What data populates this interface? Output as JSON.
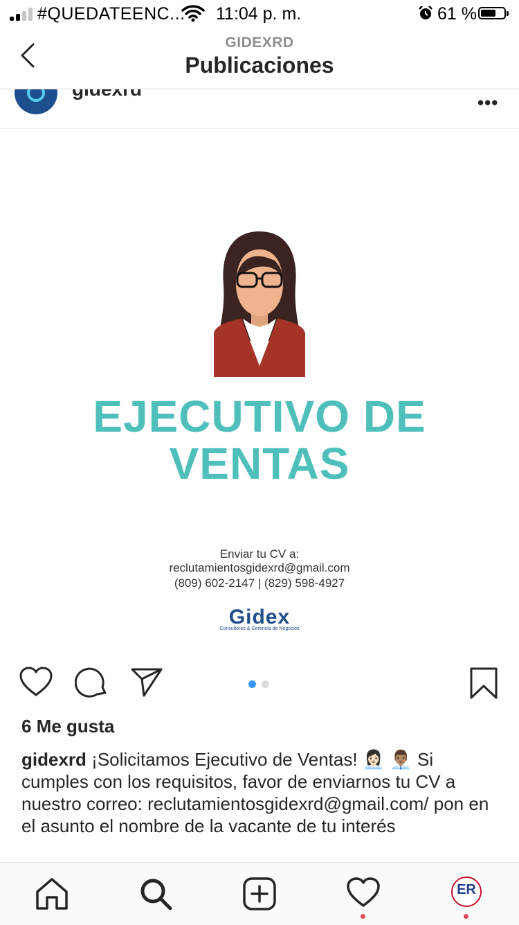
{
  "status_bar": {
    "carrier": "#QUEDATEENC...",
    "time": "11:04 p. m.",
    "battery": "61 %"
  },
  "nav": {
    "subtitle": "GIDEXRD",
    "title": "Publicaciones"
  },
  "post": {
    "username": "gidexrd",
    "image": {
      "headline_line1": "EJECUTIVO DE",
      "headline_line2": "VENTAS",
      "contact_line1": "Enviar tu CV a:",
      "contact_line2": "reclutamientosgidexrd@gmail.com",
      "contact_line3": "(809) 602-2147 | (829) 598-4927",
      "brand": "Gidex",
      "brand_tagline": "Consultores & Gerencia de Negocios"
    },
    "carousel": {
      "count": 2,
      "active": 1
    },
    "likes": "6 Me gusta",
    "caption_user": "gidexrd",
    "caption_text": "¡Solicitamos Ejecutivo de  Ventas! 👩🏻‍💼 👨🏽‍💼 Si cumples con los requisitos, favor de enviarnos tu CV a nuestro correo: reclutamientosgidexrd@gmail.com/ pon en el asunto el nombre de la vacante de tu interés"
  },
  "icons": {
    "back": "chevron-left-icon",
    "more": "more-horizontal-icon",
    "like": "heart-icon",
    "comment": "comment-icon",
    "share": "send-icon",
    "save": "bookmark-icon",
    "tab_home": "home-icon",
    "tab_search": "search-icon",
    "tab_create": "plus-square-icon",
    "tab_activity": "heart-icon",
    "tab_profile": "profile-avatar"
  },
  "tabbar": {
    "profile_initials": "ER"
  },
  "colors": {
    "headline": "#4ebfba",
    "brand": "#1f4e8c",
    "carousel_active": "#3897f0",
    "carousel_inactive": "#dbdbdb",
    "notification_dot": "#ed4956"
  }
}
